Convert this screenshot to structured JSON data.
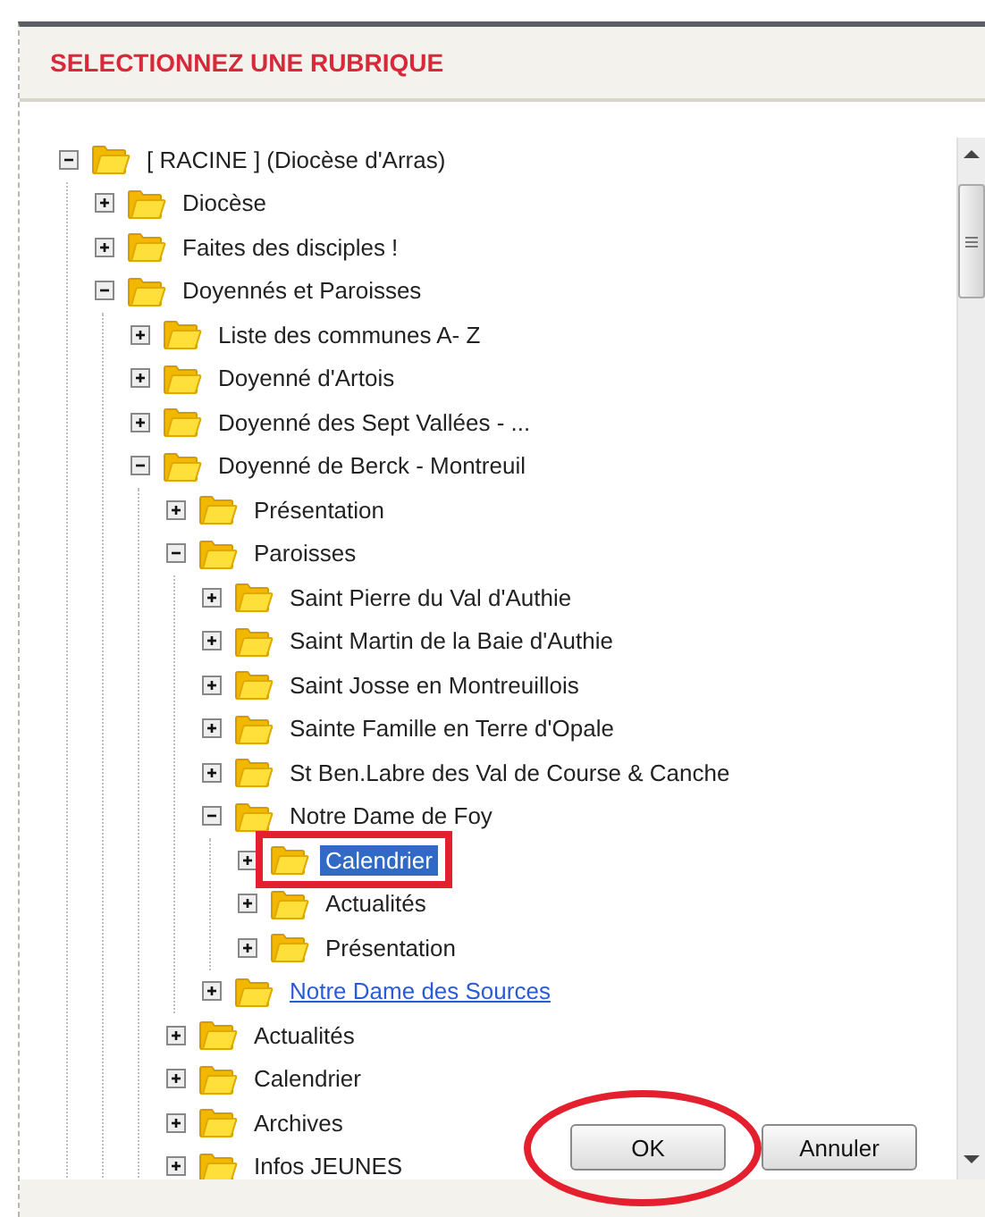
{
  "header": {
    "title": "SELECTIONNEZ UNE RUBRIQUE"
  },
  "tree": [
    {
      "label": "[ RACINE ] (Diocèse d'Arras)",
      "kind": "folder",
      "expanded": true,
      "selected": false,
      "children": [
        {
          "label": "Diocèse",
          "kind": "folder",
          "expanded": false,
          "selected": false
        },
        {
          "label": "Faites des disciples !",
          "kind": "folder",
          "expanded": false,
          "selected": false
        },
        {
          "label": "Doyennés et Paroisses",
          "kind": "folder",
          "expanded": true,
          "selected": false,
          "children": [
            {
              "label": "Liste des communes A- Z",
              "kind": "folder",
              "expanded": false,
              "selected": false
            },
            {
              "label": "Doyenné d'Artois",
              "kind": "folder",
              "expanded": false,
              "selected": false
            },
            {
              "label": "Doyenné des Sept Vallées - ...",
              "kind": "folder",
              "expanded": false,
              "selected": false
            },
            {
              "label": "Doyenné de Berck - Montreuil",
              "kind": "folder",
              "expanded": true,
              "selected": false,
              "children": [
                {
                  "label": "Présentation",
                  "kind": "folder",
                  "expanded": false,
                  "selected": false
                },
                {
                  "label": "Paroisses",
                  "kind": "folder",
                  "expanded": true,
                  "selected": false,
                  "children": [
                    {
                      "label": "Saint Pierre du Val d'Authie",
                      "kind": "folder",
                      "expanded": false,
                      "selected": false
                    },
                    {
                      "label": "Saint Martin de la Baie d'Authie",
                      "kind": "folder",
                      "expanded": false,
                      "selected": false
                    },
                    {
                      "label": "Saint Josse en Montreuillois",
                      "kind": "folder",
                      "expanded": false,
                      "selected": false
                    },
                    {
                      "label": "Sainte Famille en Terre d'Opale",
                      "kind": "folder",
                      "expanded": false,
                      "selected": false
                    },
                    {
                      "label": "St Ben.Labre des Val de Course & Canche",
                      "kind": "folder",
                      "expanded": false,
                      "selected": false
                    },
                    {
                      "label": "Notre Dame de Foy",
                      "kind": "folder",
                      "expanded": true,
                      "selected": false,
                      "children": [
                        {
                          "label": "Calendrier",
                          "kind": "folder",
                          "expanded": false,
                          "selected": true,
                          "annotated": true
                        },
                        {
                          "label": "Actualités",
                          "kind": "folder",
                          "expanded": false,
                          "selected": false
                        },
                        {
                          "label": "Présentation",
                          "kind": "folder",
                          "expanded": false,
                          "selected": false
                        }
                      ]
                    },
                    {
                      "label": "Notre Dame des Sources",
                      "kind": "link",
                      "expanded": false,
                      "selected": false
                    }
                  ]
                },
                {
                  "label": "Actualités",
                  "kind": "folder",
                  "expanded": false,
                  "selected": false
                },
                {
                  "label": "Calendrier",
                  "kind": "folder",
                  "expanded": false,
                  "selected": false
                },
                {
                  "label": "Archives",
                  "kind": "folder",
                  "expanded": false,
                  "selected": false
                },
                {
                  "label": "Infos JEUNES",
                  "kind": "folder",
                  "expanded": false,
                  "selected": false
                }
              ]
            }
          ]
        }
      ]
    }
  ],
  "buttons": [
    {
      "label": "OK",
      "annotated": true
    },
    {
      "label": "Annuler"
    }
  ]
}
